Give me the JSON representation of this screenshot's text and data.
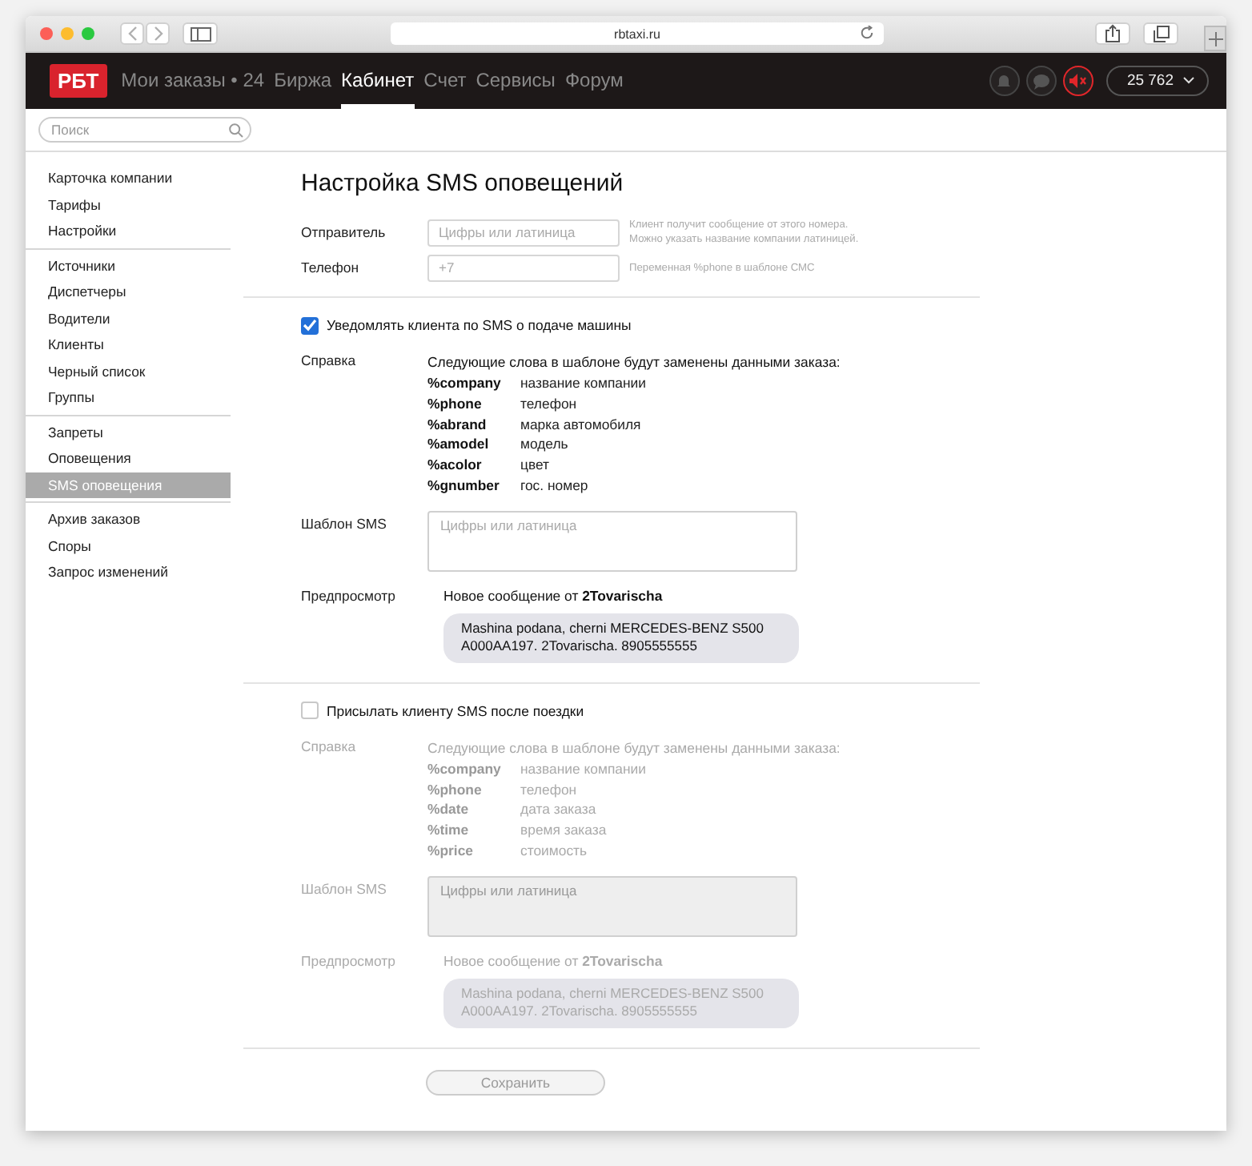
{
  "browser": {
    "url": "rbtaxi.ru"
  },
  "nav": {
    "logo": "РБТ",
    "items": [
      {
        "label": "Мои заказы • 24",
        "selected": false
      },
      {
        "label": "Биржа",
        "selected": false
      },
      {
        "label": "Кабинет",
        "selected": true
      },
      {
        "label": "Счет",
        "selected": false
      },
      {
        "label": "Сервисы",
        "selected": false
      },
      {
        "label": "Форум",
        "selected": false
      }
    ],
    "sound_muted": true,
    "balance": "25 762"
  },
  "search": {
    "placeholder": "Поиск"
  },
  "sidebar": {
    "groups": [
      [
        {
          "label": "Карточка компании",
          "selected": false
        },
        {
          "label": "Тарифы",
          "selected": false
        },
        {
          "label": "Настройки",
          "selected": false
        }
      ],
      [
        {
          "label": "Источники",
          "selected": false
        },
        {
          "label": "Диспетчеры",
          "selected": false
        },
        {
          "label": "Водители",
          "selected": false
        },
        {
          "label": "Клиенты",
          "selected": false
        },
        {
          "label": "Черный список",
          "selected": false
        },
        {
          "label": "Группы",
          "selected": false
        }
      ],
      [
        {
          "label": "Запреты",
          "selected": false
        },
        {
          "label": "Оповещения",
          "selected": false
        },
        {
          "label": "SMS оповещения",
          "selected": true
        }
      ],
      [
        {
          "label": "Архив заказов",
          "selected": false
        },
        {
          "label": "Споры",
          "selected": false
        },
        {
          "label": "Запрос изменений",
          "selected": false
        }
      ]
    ]
  },
  "page": {
    "title": "Настройка SMS оповещений",
    "fields": [
      {
        "label": "Отправитель",
        "placeholder": "Цифры или латиница",
        "hint_lines": [
          "Клиент получит сообщение от этого номера.",
          "Можно указать название компании латиницей."
        ]
      },
      {
        "label": "Телефон",
        "placeholder": "+7",
        "hint_lines": [
          "Переменная %phone в шаблоне СМС"
        ]
      }
    ],
    "notifications": [
      {
        "label": "Уведомлять клиента по SMS о подаче машины",
        "checked": true,
        "help_label": "Справка",
        "help_intro": "Следующие слова в шаблоне будут заменены данными заказа:",
        "variables": [
          {
            "name": "%company",
            "description": "название компании"
          },
          {
            "name": "%phone",
            "description": "телефон"
          },
          {
            "name": "%abrand",
            "description": "марка автомобиля"
          },
          {
            "name": "%amodel",
            "description": "модель"
          },
          {
            "name": "%acolor",
            "description": "цвет"
          },
          {
            "name": "%gnumber",
            "description": "гос. номер"
          }
        ],
        "template_label": "Шаблон SMS",
        "template_placeholder": "Цифры или латиница",
        "preview_label": "Предпросмотр",
        "preview_header": "Новое сообщение от **2Tovarischa**",
        "preview_lines": [
          "Mashina podana, cherni MERCEDES-BENZ S500",
          "A000AA197. 2Tovarischa. 8905555555"
        ]
      },
      {
        "label": "Присылать клиенту SMS после поездки",
        "checked": false,
        "help_label": "Справка",
        "help_intro": "Следующие слова в шаблоне будут заменены данными заказа:",
        "variables": [
          {
            "name": "%company",
            "description": "название компании"
          },
          {
            "name": "%phone",
            "description": "телефон"
          },
          {
            "name": "%date",
            "description": "дата заказа"
          },
          {
            "name": "%time",
            "description": "время заказа"
          },
          {
            "name": "%price",
            "description": "стоимость"
          }
        ],
        "template_label": "Шаблон SMS",
        "template_placeholder": "Цифры или латиница",
        "preview_label": "Предпросмотр",
        "preview_header": "Новое сообщение от **2Tovarischa**",
        "preview_lines": [
          "Mashina podana, cherni MERCEDES-BENZ S500",
          "A000AA197. 2Tovarischa. 8905555555"
        ]
      }
    ],
    "save": {
      "label": "Сохранить",
      "disabled": true
    }
  }
}
